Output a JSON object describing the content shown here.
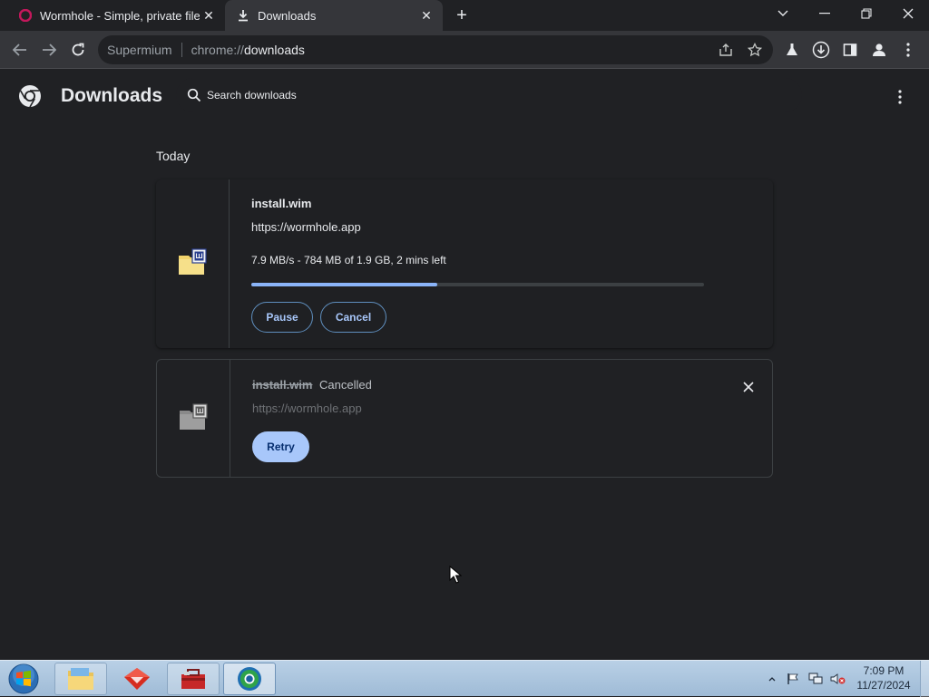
{
  "tabs": [
    {
      "title": "Wormhole - Simple, private file sharing",
      "active": false
    },
    {
      "title": "Downloads",
      "active": true
    }
  ],
  "toolbar": {
    "site_label": "Supermium",
    "url_scheme": "chrome://",
    "url_path": "downloads"
  },
  "header": {
    "title": "Downloads",
    "search_placeholder": "Search downloads"
  },
  "main": {
    "date_heading": "Today",
    "downloads": [
      {
        "file_name": "install.wim",
        "source_url": "https://wormhole.app",
        "status": "7.9 MB/s - 784 MB of 1.9 GB, 2 mins left",
        "progress_fraction": 0.41,
        "buttons": [
          "Pause",
          "Cancel"
        ]
      },
      {
        "file_name": "install.wim",
        "state_label": "Cancelled",
        "source_url": "https://wormhole.app",
        "buttons": [
          "Retry"
        ]
      }
    ]
  },
  "taskbar": {
    "time": "7:09 PM",
    "date": "11/27/2024"
  },
  "colors": {
    "background": "#202124",
    "accent": "#8ab4f8",
    "retry_fill": "#a8c7fa"
  }
}
